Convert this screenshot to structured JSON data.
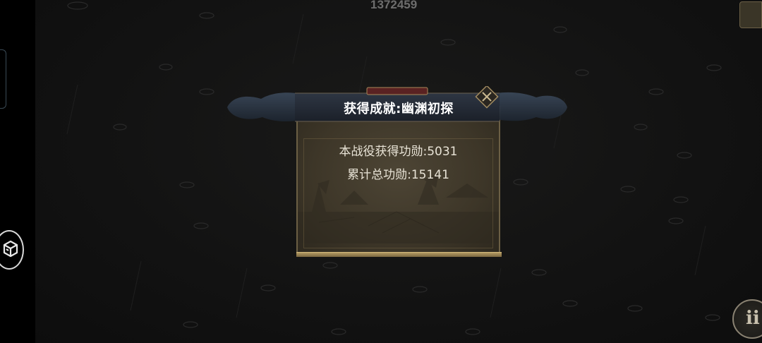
{
  "hud": {
    "score": "1372459"
  },
  "dialog": {
    "title": "获得成就:幽渊初探",
    "line1": "本战役获得功勋:5031",
    "line2": "累计总功勋:15141"
  },
  "buttons": {
    "info_glyph": "ii"
  },
  "icons": {
    "close": "close-icon",
    "side": "menu-box-icon",
    "corner": "map-scroll-icon"
  }
}
